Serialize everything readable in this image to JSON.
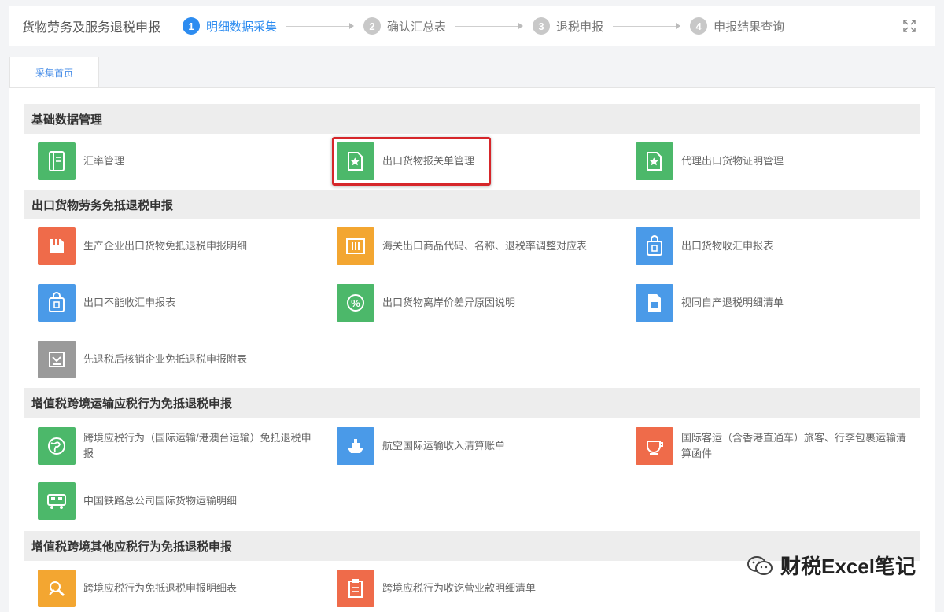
{
  "header": {
    "title": "货物劳务及服务退税申报",
    "steps": [
      {
        "num": "1",
        "label": "明细数据采集"
      },
      {
        "num": "2",
        "label": "确认汇总表"
      },
      {
        "num": "3",
        "label": "退税申报"
      },
      {
        "num": "4",
        "label": "申报结果查询"
      }
    ]
  },
  "tab": {
    "label": "采集首页"
  },
  "sections": [
    {
      "title": "基础数据管理",
      "items": [
        {
          "label": "汇率管理",
          "icon": "book-icon",
          "color": "#4cb86a"
        },
        {
          "label": "出口货物报关单管理",
          "icon": "document-star-icon",
          "color": "#4cb86a"
        },
        {
          "label": "代理出口货物证明管理",
          "icon": "document-star-icon",
          "color": "#4cb86a"
        }
      ]
    },
    {
      "title": "出口货物劳务免抵退税申报",
      "items": [
        {
          "label": "生产企业出口货物免抵退税申报明细",
          "icon": "folder-icon",
          "color": "#ef6b4a"
        },
        {
          "label": "海关出口商品代码、名称、退税率调整对应表",
          "icon": "table-icon",
          "color": "#f3a631"
        },
        {
          "label": "出口货物收汇申报表",
          "icon": "bag-icon",
          "color": "#4a9ae8"
        },
        {
          "label": "出口不能收汇申报表",
          "icon": "bag-icon",
          "color": "#4a9ae8"
        },
        {
          "label": "出口货物离岸价差异原因说明",
          "icon": "percent-icon",
          "color": "#4cb86a"
        },
        {
          "label": "视同自产退税明细清单",
          "icon": "file-icon",
          "color": "#4a9ae8"
        },
        {
          "label": "先退税后核销企业免抵退税申报附表",
          "icon": "inbox-icon",
          "color": "#9a9a9a"
        }
      ]
    },
    {
      "title": "增值税跨境运输应税行为免抵退税申报",
      "items": [
        {
          "label": "跨境应税行为（国际运输/港澳台运输）免抵退税申报",
          "icon": "globe-icon",
          "color": "#4cb86a"
        },
        {
          "label": "航空国际运输收入清算账单",
          "icon": "ship-icon",
          "color": "#4a9ae8"
        },
        {
          "label": "国际客运（含香港直通车）旅客、行李包裹运输清算函件",
          "icon": "cup-icon",
          "color": "#ef6b4a"
        },
        {
          "label": "中国铁路总公司国际货物运输明细",
          "icon": "train-icon",
          "color": "#4cb86a"
        }
      ]
    },
    {
      "title": "增值税跨境其他应税行为免抵退税申报",
      "items": [
        {
          "label": "跨境应税行为免抵退税申报明细表",
          "icon": "tools-icon",
          "color": "#f3a631"
        },
        {
          "label": "跨境应税行为收讫营业款明细清单",
          "icon": "clipboard-icon",
          "color": "#ef6b4a"
        }
      ]
    }
  ],
  "watermark": {
    "text": "财税Excel笔记"
  }
}
